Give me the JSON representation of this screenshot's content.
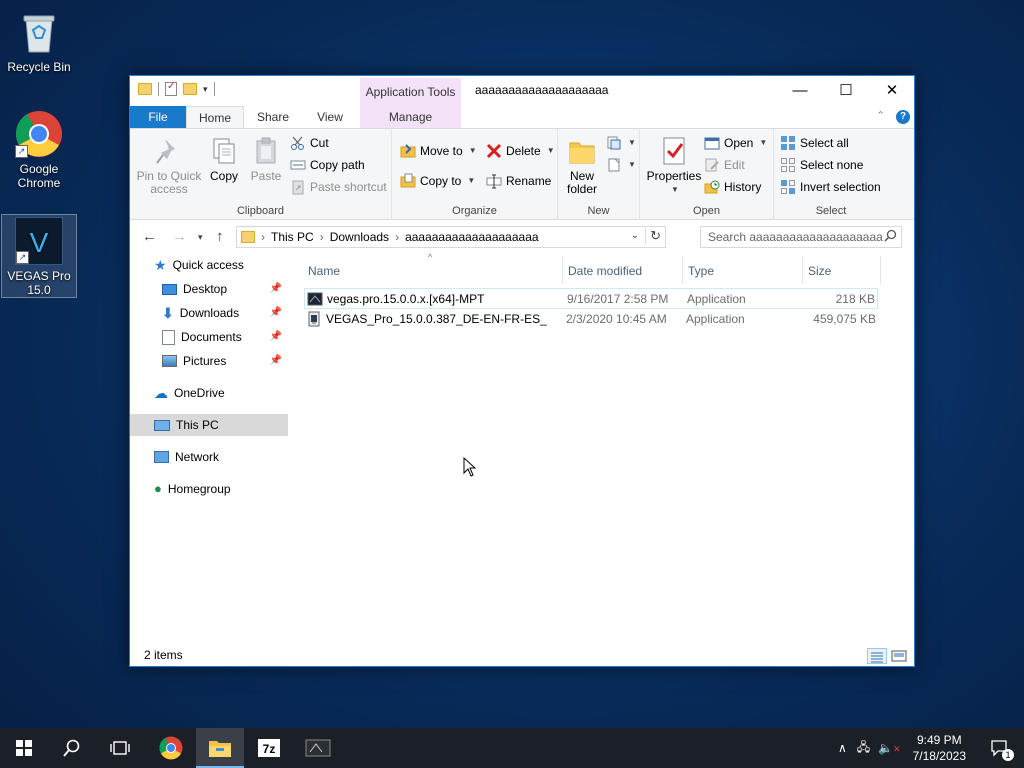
{
  "desktop": {
    "icons": [
      {
        "label": "Recycle Bin",
        "icon": "recycle-bin-icon"
      },
      {
        "label": "Google Chrome",
        "icon": "chrome-icon"
      },
      {
        "label": "VEGAS Pro 15.0",
        "icon": "vegas-pro-icon"
      }
    ]
  },
  "window": {
    "title": "aaaaaaaaaaaaaaaaaaaa",
    "context_tab_group": "Application Tools",
    "controls": {
      "minimize": "—",
      "maximize": "☐",
      "close": "✕"
    }
  },
  "tabs": {
    "file": "File",
    "home": "Home",
    "share": "Share",
    "view": "View",
    "manage": "Manage",
    "collapse": "⌃",
    "help": "?"
  },
  "ribbon": {
    "clipboard": {
      "label": "Clipboard",
      "pin_to_quick_access": "Pin to Quick access",
      "copy": "Copy",
      "paste": "Paste",
      "cut": "Cut",
      "copy_path": "Copy path",
      "paste_shortcut": "Paste shortcut"
    },
    "organize": {
      "label": "Organize",
      "move_to": "Move to",
      "copy_to": "Copy to",
      "delete": "Delete",
      "rename": "Rename"
    },
    "new": {
      "label": "New",
      "new_folder": "New folder"
    },
    "open": {
      "label": "Open",
      "properties": "Properties",
      "open": "Open",
      "edit": "Edit",
      "history": "History"
    },
    "select": {
      "label": "Select",
      "select_all": "Select all",
      "select_none": "Select none",
      "invert_selection": "Invert selection"
    }
  },
  "address": {
    "crumbs": [
      "This PC",
      "Downloads",
      "aaaaaaaaaaaaaaaaaaaa"
    ],
    "separator": "›",
    "search_placeholder": "Search aaaaaaaaaaaaaaaaaaaa"
  },
  "nav": {
    "items": [
      {
        "label": "Quick access",
        "icon": "star-icon"
      },
      {
        "label": "Desktop",
        "icon": "desktop-icon",
        "pinned": true
      },
      {
        "label": "Downloads",
        "icon": "downloads-icon",
        "pinned": true
      },
      {
        "label": "Documents",
        "icon": "documents-icon",
        "pinned": true
      },
      {
        "label": "Pictures",
        "icon": "pictures-icon",
        "pinned": true
      },
      {
        "label": "OneDrive",
        "icon": "onedrive-icon"
      },
      {
        "label": "This PC",
        "icon": "computer-icon",
        "selected": true
      },
      {
        "label": "Network",
        "icon": "network-icon"
      },
      {
        "label": "Homegroup",
        "icon": "homegroup-icon"
      }
    ]
  },
  "file_list": {
    "columns": [
      "Name",
      "Date modified",
      "Type",
      "Size"
    ],
    "rows": [
      {
        "name": "vegas.pro.15.0.0.x.[x64]-MPT",
        "date": "9/16/2017 2:58 PM",
        "type": "Application",
        "size": "218 KB"
      },
      {
        "name": "VEGAS_Pro_15.0.0.387_DE-EN-FR-ES_",
        "date": "2/3/2020 10:45 AM",
        "type": "Application",
        "size": "459,075 KB"
      }
    ]
  },
  "status": {
    "items": "2 items"
  },
  "taskbar": {
    "time": "9:49 PM",
    "date": "7/18/2023",
    "notification_count": "1",
    "apps": [
      "start-icon",
      "search-icon",
      "task-view-icon",
      "chrome-icon",
      "file-explorer-icon",
      "7zip-icon",
      "installer-icon"
    ]
  }
}
